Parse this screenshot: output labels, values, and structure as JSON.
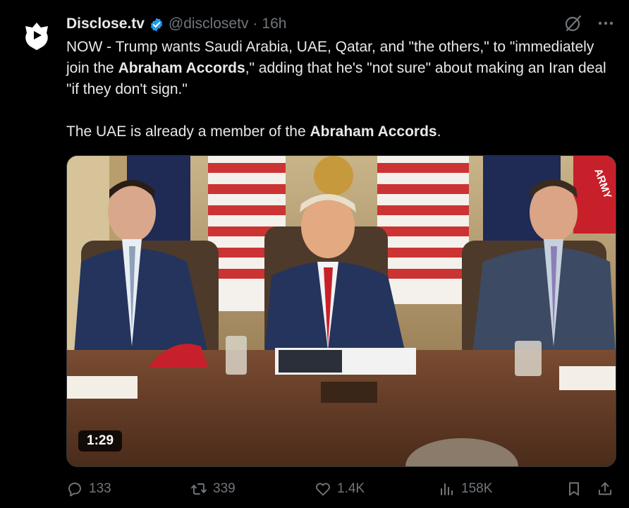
{
  "author": {
    "name": "Disclose.tv",
    "handle": "@disclosetv",
    "separator": "·",
    "time": "16h",
    "avatar_icon": "disclose-logo-icon"
  },
  "tweet": {
    "line1_pre": "NOW - Trump wants Saudi Arabia, UAE, Qatar, and \"the others,\" to \"immediately join the ",
    "line1_bold": "Abraham Accords",
    "line1_post": ",\" adding that he's \"not sure\" about making an Iran deal \"if they don't sign.\"",
    "line2_pre": "The UAE is already a member of the ",
    "line2_bold": "Abraham Accords",
    "line2_post": "."
  },
  "media": {
    "duration": "1:29",
    "flag_text": "ARMY"
  },
  "actions": {
    "replies": "133",
    "reposts": "339",
    "likes": "1.4K",
    "views": "158K"
  },
  "colors": {
    "background": "#000000",
    "text": "#e7e9ea",
    "muted": "#71767b",
    "verified": "#1d9bf0"
  }
}
